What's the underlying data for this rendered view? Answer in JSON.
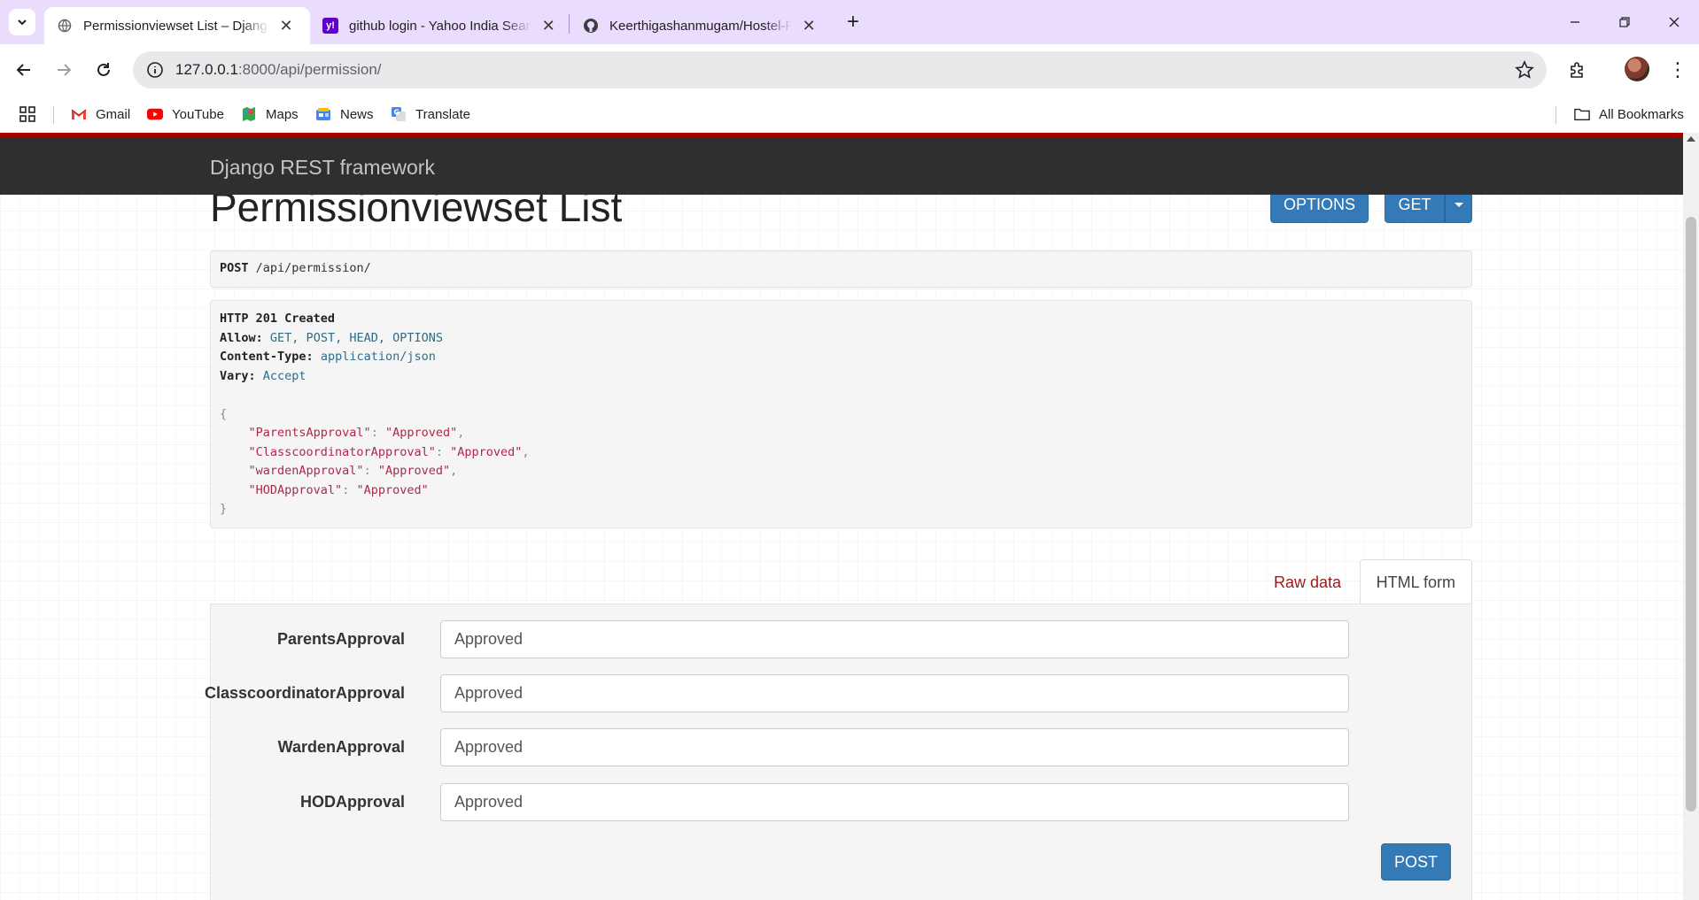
{
  "browser": {
    "tabs": [
      {
        "title": "Permissionviewset List – Django REST framework",
        "active": true
      },
      {
        "title": "github login - Yahoo India Search Results",
        "active": false
      },
      {
        "title": "Keerthigashanmugam/Hostel-Permission",
        "active": false
      }
    ],
    "address": {
      "host": "127.0.0.1",
      "path": ":8000/api/permission/"
    },
    "bookmarks": [
      {
        "label": "Gmail",
        "icon": "gmail-icon"
      },
      {
        "label": "YouTube",
        "icon": "youtube-icon"
      },
      {
        "label": "Maps",
        "icon": "maps-icon"
      },
      {
        "label": "News",
        "icon": "news-icon"
      },
      {
        "label": "Translate",
        "icon": "translate-icon"
      }
    ],
    "all_bookmarks": "All Bookmarks"
  },
  "drf": {
    "brand": "Django REST framework",
    "page_title": "Permissionviewset List",
    "options_label": "OPTIONS",
    "get_label": "GET",
    "request": {
      "method": "POST",
      "path": "/api/permission/"
    },
    "response": {
      "status": "HTTP 201 Created",
      "headers": [
        {
          "name": "Allow:",
          "value": "GET, POST, HEAD, OPTIONS"
        },
        {
          "name": "Content-Type:",
          "value": "application/json"
        },
        {
          "name": "Vary:",
          "value": "Accept"
        }
      ],
      "body": [
        {
          "key": "\"ParentsApproval\"",
          "value": "\"Approved\"",
          "sep": ","
        },
        {
          "key": "\"ClasscoordinatorApproval\"",
          "value": "\"Approved\"",
          "sep": ","
        },
        {
          "key": "\"wardenApproval\"",
          "value": "\"Approved\"",
          "sep": ","
        },
        {
          "key": "\"HODApproval\"",
          "value": "\"Approved\"",
          "sep": ""
        }
      ]
    },
    "tabs": {
      "raw": "Raw data",
      "html": "HTML form"
    },
    "form": {
      "fields": [
        {
          "label": "ParentsApproval",
          "value": "Approved"
        },
        {
          "label": "ClasscoordinatorApproval",
          "value": "Approved"
        },
        {
          "label": "WardenApproval",
          "value": "Approved"
        },
        {
          "label": "HODApproval",
          "value": "Approved"
        }
      ],
      "submit_label": "POST"
    }
  },
  "colors": {
    "tabbar": "#e9dcfc",
    "navbar": "#2f2f2f",
    "accent_red": "#a30000",
    "button_blue": "#337ab7"
  }
}
